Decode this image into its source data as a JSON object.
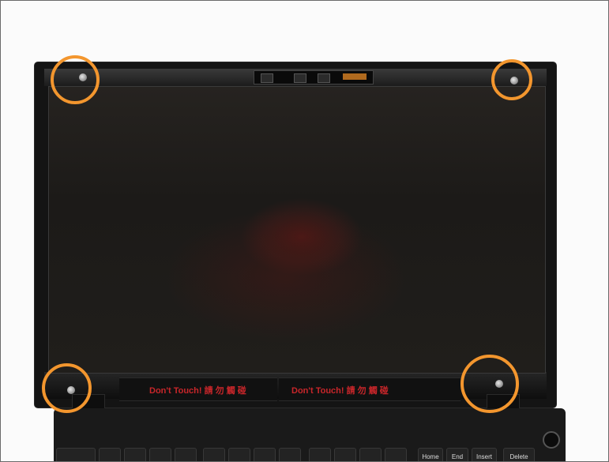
{
  "image": {
    "tape_warnings": [
      "Don't Touch! 請 勿 觸 碰",
      "Don't Touch! 請 勿 觸 碰"
    ],
    "keyboard_keys": [
      "Home",
      "End",
      "Insert",
      "Delete"
    ],
    "highlight_color": "#f3962e",
    "highlight_markers": [
      {
        "label": "top-left screw"
      },
      {
        "label": "top-right screw"
      },
      {
        "label": "bottom-left screw"
      },
      {
        "label": "bottom-right screw"
      }
    ]
  }
}
